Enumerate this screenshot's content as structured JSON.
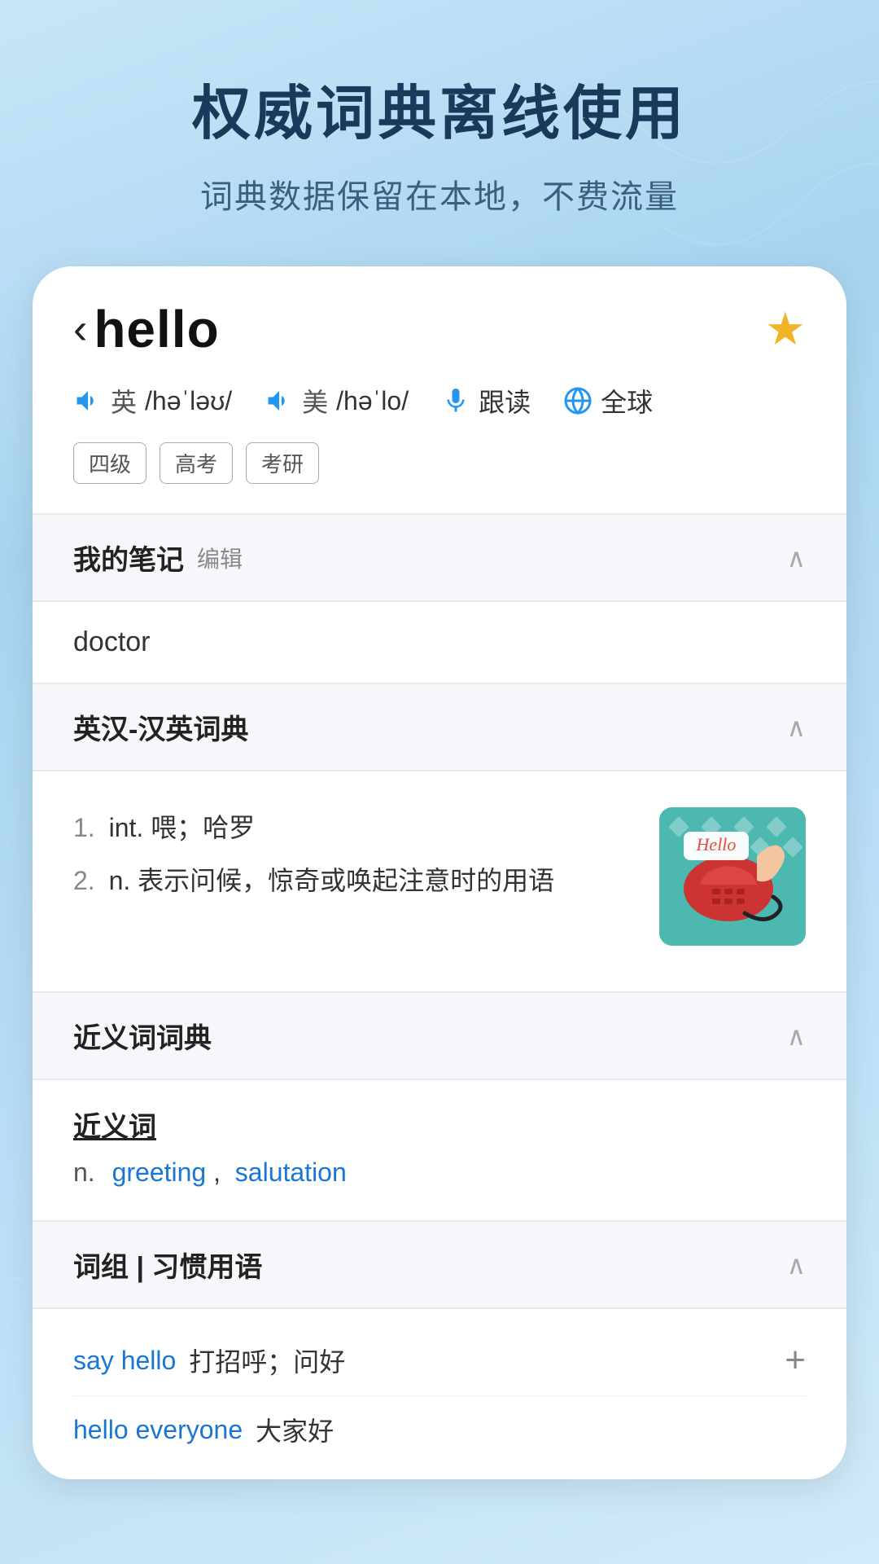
{
  "background": {
    "gradient_start": "#c8e6f7",
    "gradient_end": "#d0eaf8"
  },
  "header": {
    "main_title": "权威词典离线使用",
    "sub_title": "词典数据保留在本地，不费流量"
  },
  "word_card": {
    "back_icon": "‹",
    "word": "hello",
    "star_icon": "★",
    "pronunciations": [
      {
        "flag": "英",
        "ipa": "/həˈləʊ/"
      },
      {
        "flag": "美",
        "ipa": "/həˈlo/"
      }
    ],
    "follow_read_label": "跟读",
    "global_label": "全球",
    "tags": [
      "四级",
      "高考",
      "考研"
    ]
  },
  "notes_section": {
    "title": "我的笔记",
    "edit_label": "编辑",
    "chevron": "∧",
    "content": "doctor"
  },
  "dictionary_section": {
    "title": "英汉-汉英词典",
    "chevron": "∧",
    "entries": [
      {
        "num": "1.",
        "pos": "int.",
        "text": "喂；哈罗"
      },
      {
        "num": "2.",
        "pos": "n.",
        "text": "表示问候，惊奇或唤起注意时的用语"
      }
    ],
    "image_alt": "Hello telephone image"
  },
  "synonyms_section": {
    "title": "近义词词典",
    "chevron": "∧",
    "heading": "近义词",
    "pos": "n.",
    "words": [
      "greeting",
      "salutation"
    ]
  },
  "phrases_section": {
    "title": "词组 | 习惯用语",
    "chevron": "∧",
    "phrases": [
      {
        "phrase": "say hello",
        "meaning": "打招呼；问好",
        "has_add": true
      },
      {
        "phrase": "hello everyone",
        "meaning": "大家好",
        "has_add": false
      }
    ]
  }
}
